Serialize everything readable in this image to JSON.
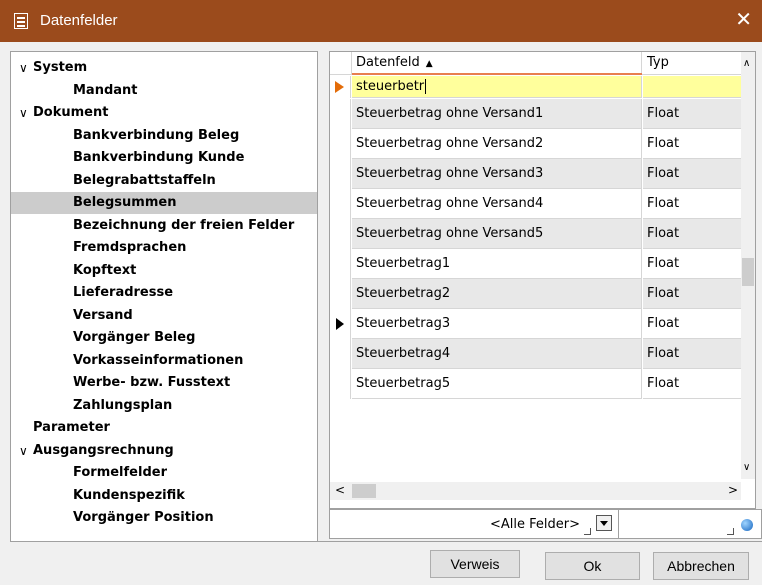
{
  "window": {
    "title": "Datenfelder",
    "close_glyph": "✕",
    "icon": "table-icon"
  },
  "tree": {
    "items": [
      {
        "label": "System",
        "level": 0,
        "expanded": true
      },
      {
        "label": "Mandant",
        "level": 1
      },
      {
        "label": "Dokument",
        "level": 0,
        "expanded": true
      },
      {
        "label": "Bankverbindung Beleg",
        "level": 1
      },
      {
        "label": "Bankverbindung Kunde",
        "level": 1
      },
      {
        "label": "Belegrabattstaffeln",
        "level": 1
      },
      {
        "label": "Belegsummen",
        "level": 1,
        "selected": true
      },
      {
        "label": "Bezeichnung der freien Felder",
        "level": 1
      },
      {
        "label": "Fremdsprachen",
        "level": 1
      },
      {
        "label": "Kopftext",
        "level": 1
      },
      {
        "label": "Lieferadresse",
        "level": 1
      },
      {
        "label": "Versand",
        "level": 1
      },
      {
        "label": "Vorgänger Beleg",
        "level": 1
      },
      {
        "label": "Vorkasseinformationen",
        "level": 1
      },
      {
        "label": "Werbe- bzw. Fusstext",
        "level": 1
      },
      {
        "label": "Zahlungsplan",
        "level": 1
      },
      {
        "label": "Parameter",
        "level": 0
      },
      {
        "label": "Ausgangsrechnung",
        "level": 0,
        "expanded": true
      },
      {
        "label": "Formelfelder",
        "level": 1
      },
      {
        "label": "Kundenspezifik",
        "level": 1
      },
      {
        "label": "Vorgänger Position",
        "level": 1
      }
    ],
    "chevron_glyph": "∨"
  },
  "grid": {
    "columns": {
      "datenfeld": "Datenfeld",
      "typ": "Typ",
      "sort_glyph": "▲"
    },
    "filter_value": "steuerbetr",
    "rows": [
      {
        "name": "Steuerbetrag ohne Versand1",
        "typ": "Float"
      },
      {
        "name": "Steuerbetrag ohne Versand2",
        "typ": "Float"
      },
      {
        "name": "Steuerbetrag ohne Versand3",
        "typ": "Float"
      },
      {
        "name": "Steuerbetrag ohne Versand4",
        "typ": "Float"
      },
      {
        "name": "Steuerbetrag ohne Versand5",
        "typ": "Float"
      },
      {
        "name": "Steuerbetrag1",
        "typ": "Float"
      },
      {
        "name": "Steuerbetrag2",
        "typ": "Float"
      },
      {
        "name": "Steuerbetrag3",
        "typ": "Float",
        "current": true
      },
      {
        "name": "Steuerbetrag4",
        "typ": "Float"
      },
      {
        "name": "Steuerbetrag5",
        "typ": "Float"
      }
    ],
    "scroll": {
      "up": "∧",
      "down": "∨",
      "left": "<",
      "right": ">"
    }
  },
  "filterbar": {
    "field_filter": "<Alle Felder>"
  },
  "buttons": {
    "verweis": "Verweis",
    "ok": "Ok",
    "abbrechen": "Abbrechen"
  }
}
